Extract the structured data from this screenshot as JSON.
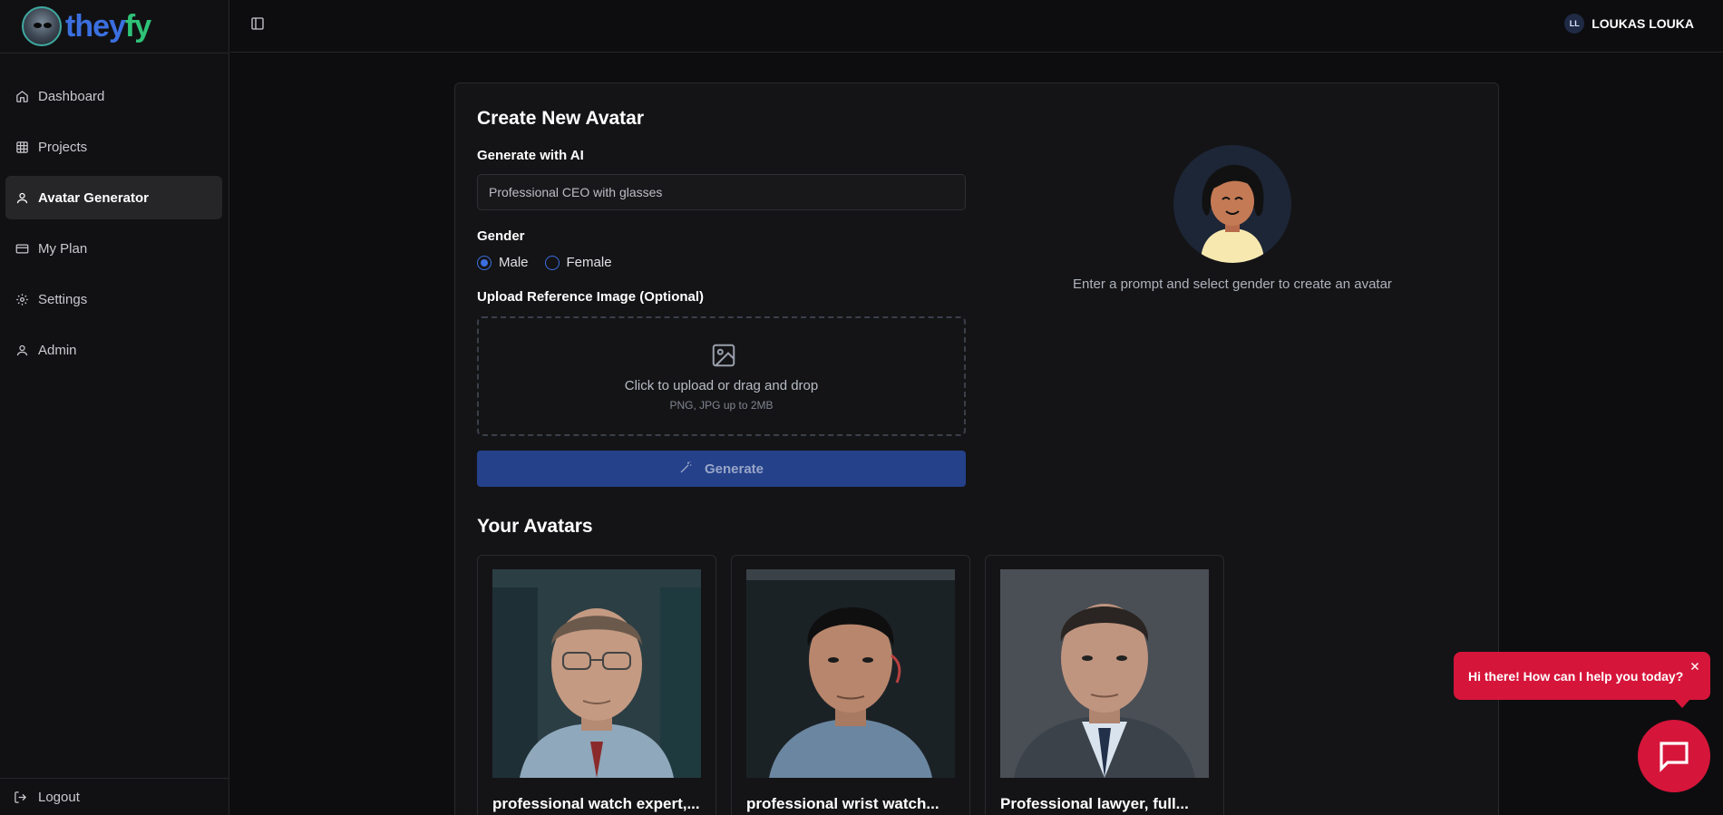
{
  "app": {
    "logo_text_part1": "they",
    "logo_text_part2": "fy",
    "brand_colors": {
      "blue": "#3b6fe0",
      "green": "#2fc278",
      "accent_red": "#d6153a"
    }
  },
  "sidebar": {
    "items": [
      {
        "label": "Dashboard",
        "icon": "home-icon",
        "active": false
      },
      {
        "label": "Projects",
        "icon": "grid-icon",
        "active": false
      },
      {
        "label": "Avatar Generator",
        "icon": "user-icon",
        "active": true
      },
      {
        "label": "My Plan",
        "icon": "credit-card-icon",
        "active": false
      },
      {
        "label": "Settings",
        "icon": "gear-icon",
        "active": false
      },
      {
        "label": "Admin",
        "icon": "user-icon",
        "active": false
      }
    ],
    "logout_label": "Logout"
  },
  "header": {
    "user_initials": "LL",
    "user_name": "LOUKAS LOUKA"
  },
  "create": {
    "title": "Create New Avatar",
    "ai_label": "Generate with AI",
    "prompt_value": "Professional CEO with glasses",
    "gender_label": "Gender",
    "gender_options": [
      "Male",
      "Female"
    ],
    "gender_selected": "Male",
    "upload_label": "Upload Reference Image (Optional)",
    "upload_main": "Click to upload or drag and drop",
    "upload_sub": "PNG, JPG up to 2MB",
    "generate_label": "Generate",
    "preview_text": "Enter a prompt and select gender to create an avatar"
  },
  "avatars": {
    "title": "Your Avatars",
    "items": [
      {
        "caption": "professional watch expert,..."
      },
      {
        "caption": "professional wrist watch..."
      },
      {
        "caption": "Professional lawyer, full..."
      }
    ]
  },
  "chat": {
    "message": "Hi there! How can I help you today?"
  }
}
